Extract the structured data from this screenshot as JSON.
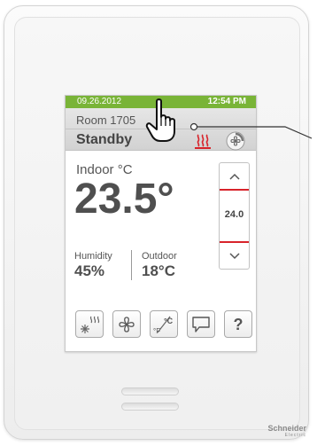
{
  "device": {
    "date": "09.26.2012",
    "time": "12:54 PM",
    "room": "Room 1705",
    "mode": "Standby",
    "indoor_label": "Indoor °C",
    "indoor_temp": "23.5°",
    "setpoint": "24.0",
    "humidity_label": "Humidity",
    "humidity_value": "45%",
    "outdoor_label": "Outdoor",
    "outdoor_value": "18°C",
    "brand": "Schneider",
    "brand_sub": "Electric"
  },
  "buttons": [
    {
      "name": "mode-button",
      "icon": "snow-heat-icon"
    },
    {
      "name": "fan-button",
      "icon": "fan-icon"
    },
    {
      "name": "units-button",
      "icon": "celsius-fahrenheit-icon"
    },
    {
      "name": "message-button",
      "icon": "speech-bubble-icon"
    },
    {
      "name": "help-button",
      "icon": "question-icon",
      "label": "?"
    }
  ],
  "colors": {
    "topbar": "#79b437",
    "accent_red": "#d8232a",
    "text": "#4f4f4f"
  }
}
